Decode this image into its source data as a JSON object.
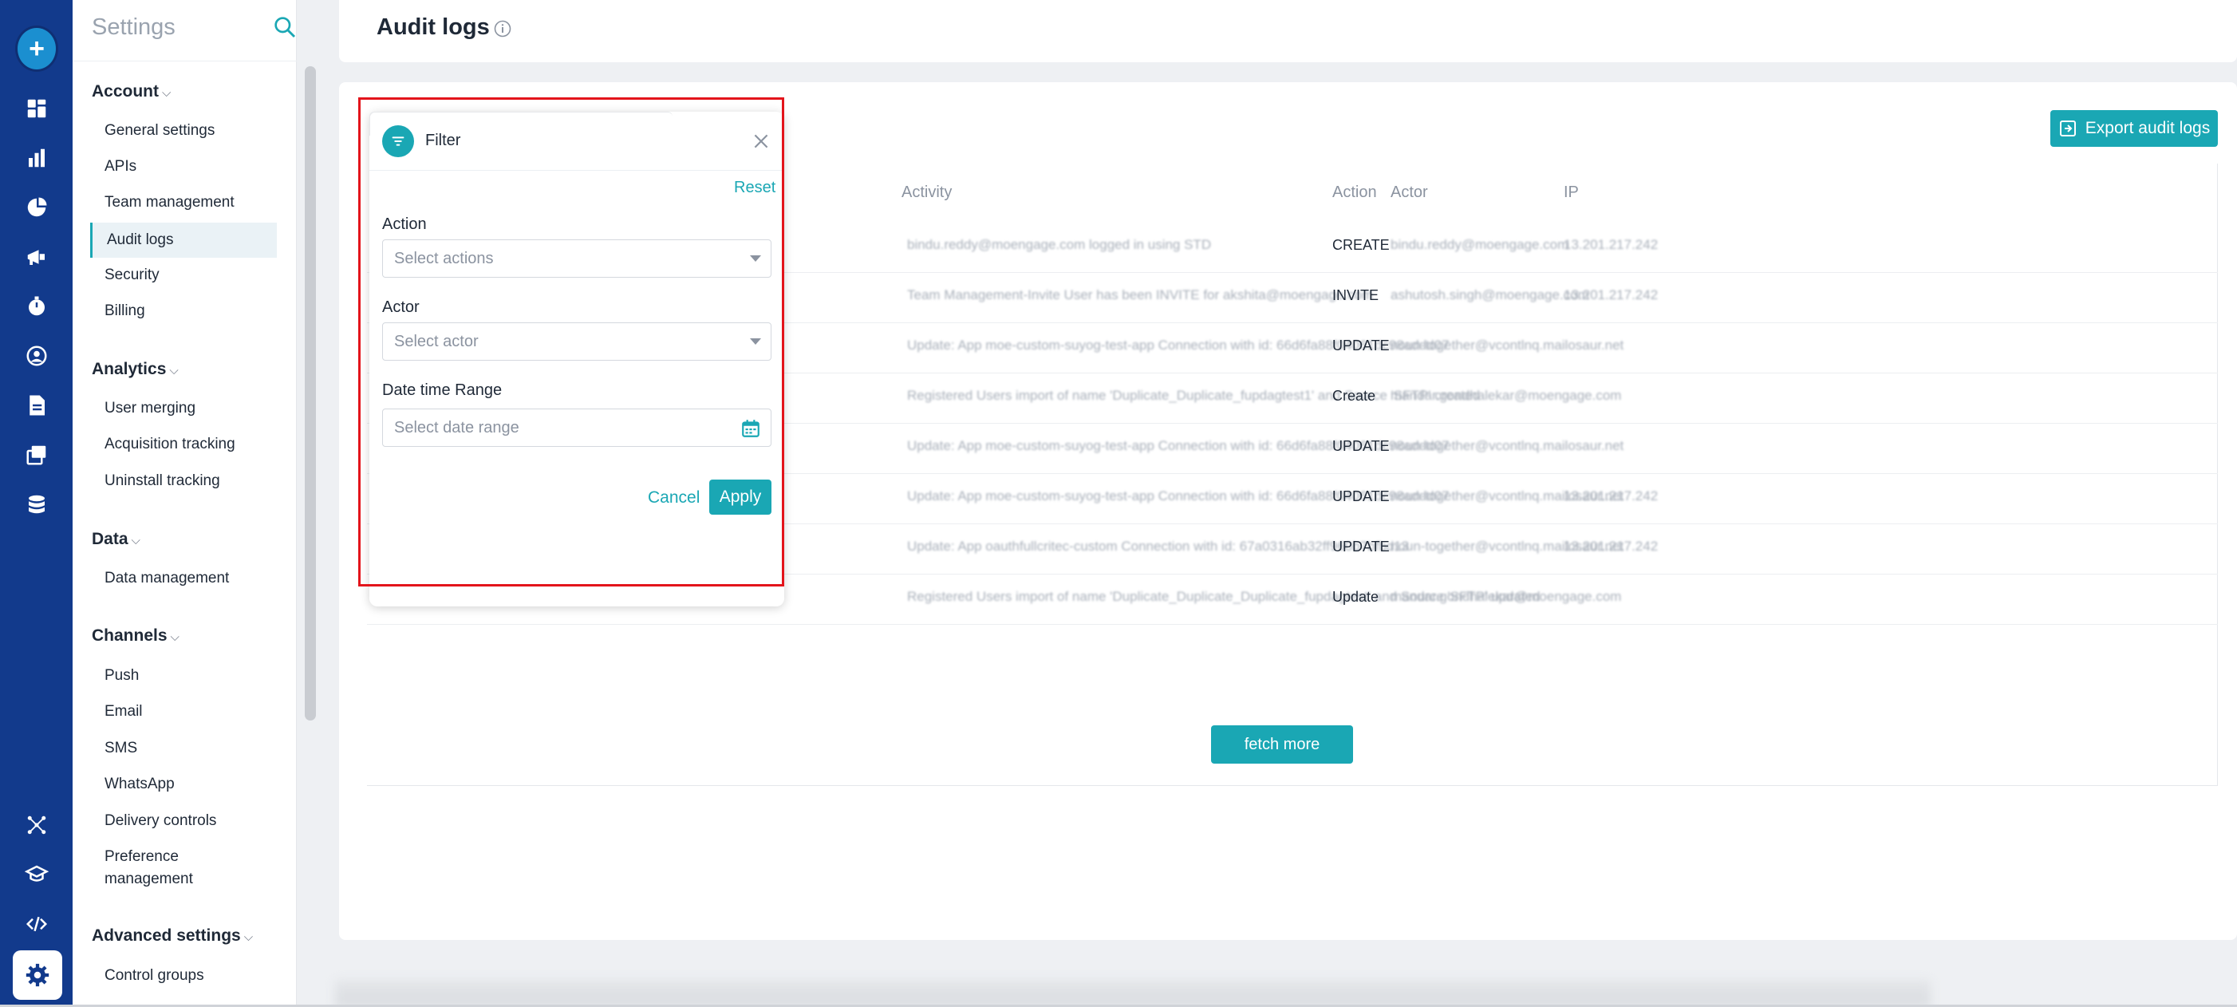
{
  "sidebar": {
    "title": "Settings",
    "groups": [
      {
        "title": "Account",
        "items": [
          "General settings",
          "APIs",
          "Team management",
          "Audit logs",
          "Security",
          "Billing"
        ]
      },
      {
        "title": "Analytics",
        "items": [
          "User merging",
          "Acquisition tracking",
          "Uninstall tracking"
        ]
      },
      {
        "title": "Data",
        "items": [
          "Data management"
        ]
      },
      {
        "title": "Channels",
        "items": [
          "Push",
          "Email",
          "SMS",
          "WhatsApp",
          "Delivery controls",
          "Preference management"
        ]
      },
      {
        "title": "Advanced settings",
        "items": [
          "Control groups"
        ]
      }
    ],
    "active_item": "Audit logs"
  },
  "rail": {
    "icons": [
      "create-icon",
      "dashboard-icon",
      "analyze-icon",
      "segment-icon",
      "campaign-icon",
      "flows-icon",
      "users-icon",
      "content-icon",
      "templates-icon",
      "data-icon",
      "integrations-icon",
      "learn-icon",
      "developer-icon",
      "settings-icon"
    ]
  },
  "header": {
    "title": "Audit logs"
  },
  "toolbar": {
    "export_label": "Export audit logs"
  },
  "table": {
    "columns": [
      "Activity",
      "Action",
      "Actor",
      "IP"
    ],
    "rows": [
      {
        "activity": "bindu.reddy@moengage.com logged in using STD",
        "action": "CREATE",
        "actor": "bindu.reddy@moengage.com",
        "ip": "13.201.217.242"
      },
      {
        "activity": "Team Management-Invite User has been INVITE for akshita@moengage.com",
        "action": "INVITE",
        "actor": "ashutosh.singh@moengage.com",
        "ip": "13.201.217.242"
      },
      {
        "activity": "Update: App moe-custom-suyog-test-app Connection with id: 66d6fa88f04061dc98addd07",
        "action": "UPDATE",
        "actor": "noun-together@vcontlnq.mailosaur.net",
        "ip": ""
      },
      {
        "activity": "Registered Users import of name 'Duplicate_Duplicate_fupdagtest1' and Source 'SFTP' created",
        "action": "Create",
        "actor": "mandar.gondhalekar@moengage.com",
        "ip": ""
      },
      {
        "activity": "Update: App moe-custom-suyog-test-app Connection with id: 66d6fa88f04061dc98addd07",
        "action": "UPDATE",
        "actor": "noun-together@vcontlnq.mailosaur.net",
        "ip": ""
      },
      {
        "activity": "Update: App moe-custom-suyog-test-app Connection with id: 66d6fa88f04061dc98addd07",
        "action": "UPDATE",
        "actor": "noun-together@vcontlnq.mailosaur.net",
        "ip": "13.201.217.242"
      },
      {
        "activity": "Update: App oauthfullcritec-custom Connection with id: 67a0316ab32ff960b7bfbd13",
        "action": "UPDATE",
        "actor": "noun-together@vcontlnq.mailosaur.net",
        "ip": "13.201.217.242"
      },
      {
        "activity": "Registered Users import of name 'Duplicate_Duplicate_Duplicate_fupdagtest' and Source 'SFTP' updated",
        "action": "Update",
        "actor": "mandar.gondhalekar@moengage.com",
        "ip": ""
      }
    ],
    "fetch_more_label": "fetch more"
  },
  "filter": {
    "title": "Filter",
    "reset_label": "Reset",
    "action_label": "Action",
    "action_placeholder": "Select actions",
    "actor_label": "Actor",
    "actor_placeholder": "Select actor",
    "date_label": "Date time Range",
    "date_placeholder": "Select date range",
    "cancel_label": "Cancel",
    "apply_label": "Apply"
  },
  "colors": {
    "accent": "#1aa7b4",
    "rail": "#123a8c",
    "highlight": "#e3141b"
  }
}
